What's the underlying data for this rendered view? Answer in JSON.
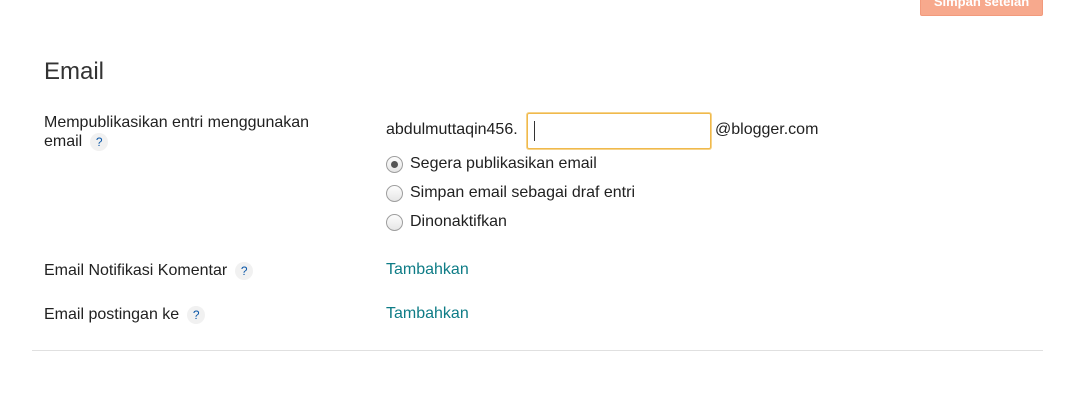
{
  "toolbar": {
    "save_label": "Simpan setelan"
  },
  "section": {
    "title": "Email"
  },
  "post_by_email": {
    "label_line1": "Mempublikasikan entri menggunakan",
    "label_line2": "email",
    "help": "?",
    "prefix": "abdulmuttaqin456.",
    "input_value": "",
    "domain": "@blogger.com",
    "options": [
      {
        "label": "Segera publikasikan email",
        "checked": true
      },
      {
        "label": "Simpan email sebagai draf entri",
        "checked": false
      },
      {
        "label": "Dinonaktifkan",
        "checked": false
      }
    ]
  },
  "comment_notification": {
    "label": "Email Notifikasi Komentar",
    "help": "?",
    "action": "Tambahkan"
  },
  "post_to": {
    "label": "Email postingan ke",
    "help": "?",
    "action": "Tambahkan"
  },
  "colors": {
    "accent_link": "#0e7c86",
    "save_button": "#f7a98d",
    "input_focus": "#f0b94c"
  }
}
